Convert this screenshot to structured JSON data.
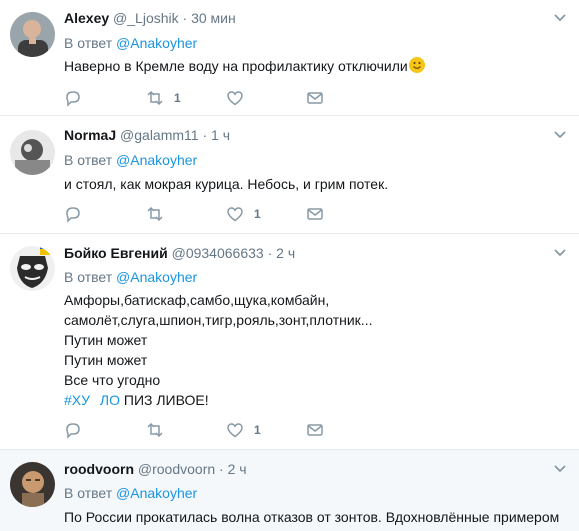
{
  "tweets": [
    {
      "name": "Alexey",
      "handle": "@_Ljoshik",
      "time": "30 мин",
      "reply_prefix": "В ответ",
      "reply_to": "@Anakoyher",
      "lines": [
        "Наверно в Кремле воду на профилактику отключили"
      ],
      "reply_count": "",
      "retweet_count": "1",
      "like_count": ""
    },
    {
      "name": "NormaJ",
      "handle": "@galamm11",
      "time": "1 ч",
      "reply_prefix": "В ответ",
      "reply_to": "@Anakoyher",
      "lines": [
        "и стоял, как мокрая курица. Небось, и грим потек."
      ],
      "reply_count": "",
      "retweet_count": "",
      "like_count": "1"
    },
    {
      "name": "Бойко Евгений",
      "handle": "@0934066633",
      "time": "2 ч",
      "reply_prefix": "В ответ",
      "reply_to": "@Anakoyher",
      "lines": [
        "Амфоры,батискаф,самбо,щука,комбайн,",
        "самолёт,слуга,шпион,тигр,рояль,зонт,плотник...",
        "Путин может",
        "Путин может",
        "Все что угодно"
      ],
      "hashtag": "#ХУ",
      "hashtag_tail": "ЛО",
      "caps_tail": "ПИЗ ЛИВОЕ!",
      "reply_count": "",
      "retweet_count": "",
      "like_count": "1"
    },
    {
      "name": "roodvoorn",
      "handle": "@roodvoorn",
      "time": "2 ч",
      "reply_prefix": "В ответ",
      "reply_to": "@Anakoyher",
      "lines": [
        "По России прокатилась волна отказов от зонтов. Вдохновлённые примером"
      ]
    }
  ],
  "separator": "·",
  "colors": {
    "text": "#14171a",
    "secondary": "#657786",
    "link": "#1b95e0",
    "border": "#e6ecf0",
    "background": "#ffffff"
  },
  "icons": [
    "reply-icon",
    "retweet-icon",
    "heart-icon",
    "message-icon",
    "chevron-down-icon"
  ]
}
